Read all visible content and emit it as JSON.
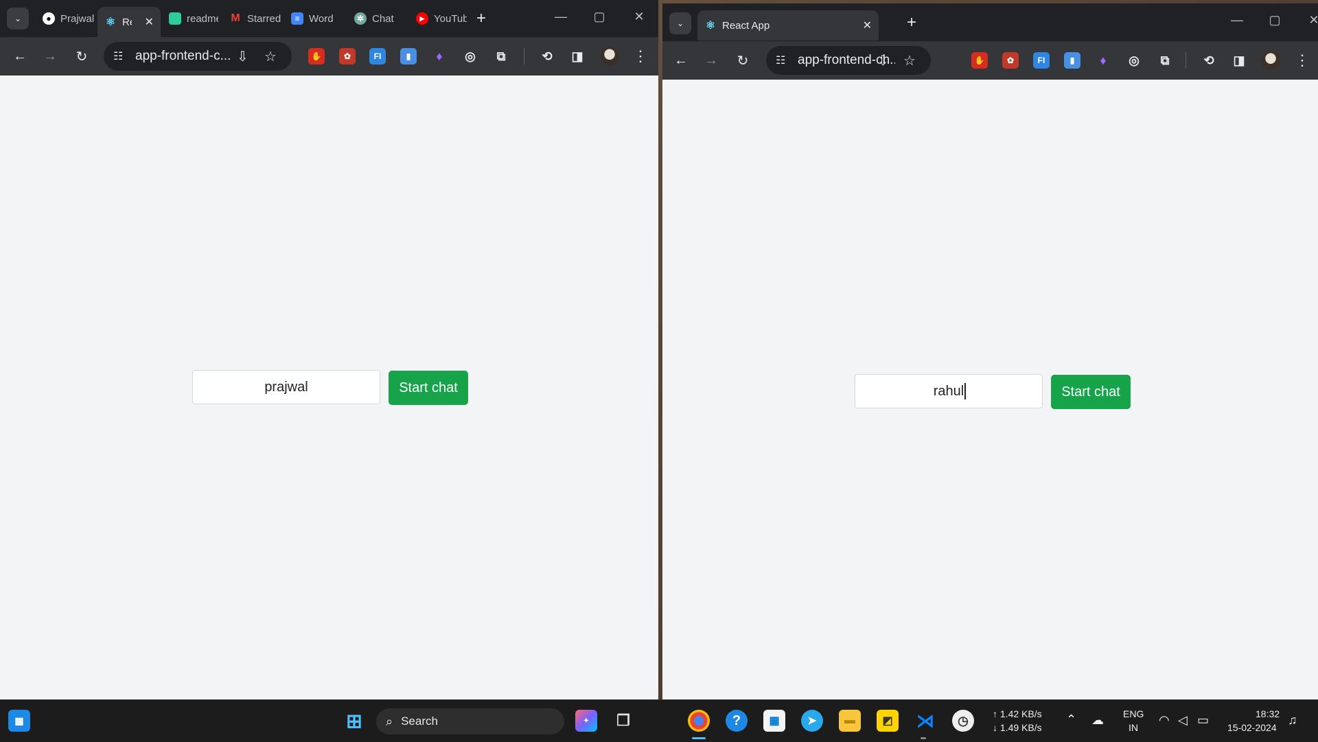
{
  "left_window": {
    "tabs": [
      {
        "label": "Prajwal",
        "icon": "github-icon"
      },
      {
        "label": "React App",
        "icon": "react-icon",
        "active": true
      },
      {
        "label": "readme",
        "icon": "green-app-icon"
      },
      {
        "label": "Starred",
        "icon": "gmail-icon"
      },
      {
        "label": "Word",
        "icon": "docs-icon"
      },
      {
        "label": "Chat",
        "icon": "chatgpt-icon"
      },
      {
        "label": "YouTube",
        "icon": "youtube-icon"
      }
    ],
    "address": "app-frontend-c...",
    "page": {
      "username_value": "prajwal",
      "start_button_label": "Start chat"
    }
  },
  "right_window": {
    "tabs": [
      {
        "label": "React App",
        "icon": "react-icon",
        "active": true
      }
    ],
    "address": "app-frontend-ch...",
    "page": {
      "username_value": "rahul",
      "start_button_label": "Start chat"
    }
  },
  "taskbar": {
    "search_placeholder": "Search",
    "network_up": "↑ 1.42 KB/s",
    "network_down": "↓ 1.49 KB/s",
    "language_top": "ENG",
    "language_bottom": "IN",
    "time": "18:32",
    "date": "15-02-2024"
  },
  "colors": {
    "accent_green": "#16a34a",
    "page_bg": "#f3f4f6",
    "chrome_dark": "#202124",
    "chrome_toolbar": "#35363a"
  }
}
